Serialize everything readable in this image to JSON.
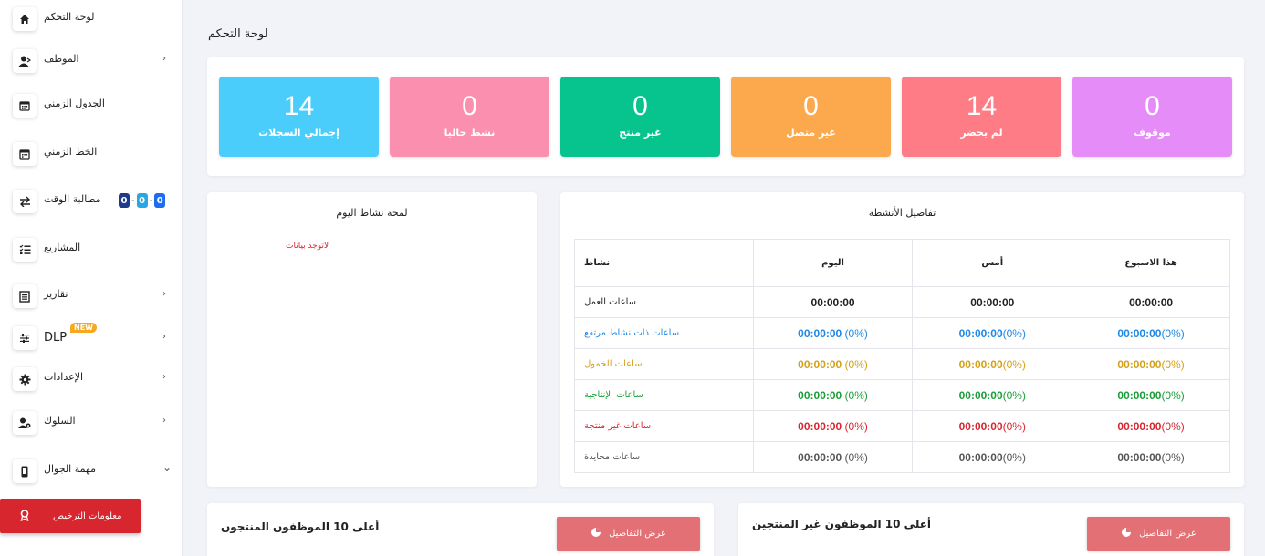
{
  "sidebar": {
    "items": [
      {
        "label": "لوحة التحكم",
        "icon": "home-icon"
      },
      {
        "label": "الموظف",
        "icon": "employee-icon",
        "chevron": "›"
      },
      {
        "label": "الجدول الزمني",
        "icon": "calendar-icon"
      },
      {
        "label": "الخط الزمني",
        "icon": "calendar-icon"
      },
      {
        "label": "مطالبة الوقت",
        "icon": "exchange-icon"
      },
      {
        "label": "المشاريع",
        "icon": "tasks-icon"
      },
      {
        "label": "تقارير",
        "icon": "report-icon",
        "chevron": "›"
      },
      {
        "label": "DLP",
        "icon": "sliders-icon",
        "chevron": "›",
        "badge": "NEW"
      },
      {
        "label": "الإعدادات",
        "icon": "gear-icon",
        "chevron": "›"
      },
      {
        "label": "السلوك",
        "icon": "user-cog-icon",
        "chevron": "›"
      },
      {
        "label": "مهمة الجوال",
        "icon": "mobile-icon",
        "chevron": "⌄"
      }
    ],
    "time_claim_badges": [
      "0",
      "-",
      "0",
      "-",
      "0"
    ],
    "time_claim_badge_colors": [
      "#1e3a8a",
      "#2aa7e0",
      "#1d6cf2"
    ],
    "license_button": "معلومات الترخيص"
  },
  "page_title": "لوحة التحكم",
  "stats": [
    {
      "value": "14",
      "label": "إجمالي السجلات",
      "color": "#4bcdfb"
    },
    {
      "value": "0",
      "label": "نشط حاليا",
      "color": "#fb8fb0"
    },
    {
      "value": "0",
      "label": "غير منتج",
      "color": "#07c48f"
    },
    {
      "value": "0",
      "label": "غير متصل",
      "color": "#fca84c"
    },
    {
      "value": "14",
      "label": "لم يحضر",
      "color": "#fd7c85"
    },
    {
      "value": "0",
      "label": "موقوف",
      "color": "#e68cf9"
    }
  ],
  "glance": {
    "title": "لمحة نشاط اليوم",
    "no_data": "لاتوجد بيانات"
  },
  "activities": {
    "title": "تفاصيل الأنشطة",
    "headers": {
      "activity": "نشاط",
      "today": "اليوم",
      "yesterday": "أمس",
      "week": "هذا الاسبوع"
    },
    "rows": [
      {
        "name": "ساعات العمل",
        "color": "#222222",
        "today": "00:00:00",
        "today_pct": "",
        "yesterday": "00:00:00",
        "yesterday_pct": "",
        "week": "00:00:00",
        "week_pct": ""
      },
      {
        "name": "ساعات ذات نشاط مرتفع",
        "color": "#1e88e5",
        "today": "00:00:00",
        "today_pct": " (0%)",
        "yesterday": "00:00:00",
        "yesterday_pct": "(0%)",
        "week": "00:00:00",
        "week_pct": "(0%)"
      },
      {
        "name": "ساعات الخمول",
        "color": "#d4a017",
        "today": "00:00:00",
        "today_pct": " (0%)",
        "yesterday": "00:00:00",
        "yesterday_pct": "(0%)",
        "week": "00:00:00",
        "week_pct": "(0%)"
      },
      {
        "name": "ساعات الإنتاجية",
        "color": "#1a9e38",
        "today": "00:00:00",
        "today_pct": " (0%)",
        "yesterday": "00:00:00",
        "yesterday_pct": "(0%)",
        "week": "00:00:00",
        "week_pct": "(0%)"
      },
      {
        "name": "ساعات غير منتجة",
        "color": "#d8262f",
        "today": "00:00:00",
        "today_pct": " (0%)",
        "yesterday": "00:00:00",
        "yesterday_pct": "(0%)",
        "week": "00:00:00",
        "week_pct": "(0%)"
      },
      {
        "name": "ساعات محايدة",
        "color": "#555555",
        "today": "00:00:00",
        "today_pct": " (0%)",
        "yesterday": "00:00:00",
        "yesterday_pct": "(0%)",
        "week": "00:00:00",
        "week_pct": "(0%)"
      }
    ]
  },
  "top_productive": {
    "title": "أعلى 10 الموظفون المنتجون",
    "button": "عرض التفاصيل"
  },
  "top_unproductive": {
    "title": "أعلى 10 الموظفون غير المنتجين",
    "button": "عرض التفاصيل"
  }
}
